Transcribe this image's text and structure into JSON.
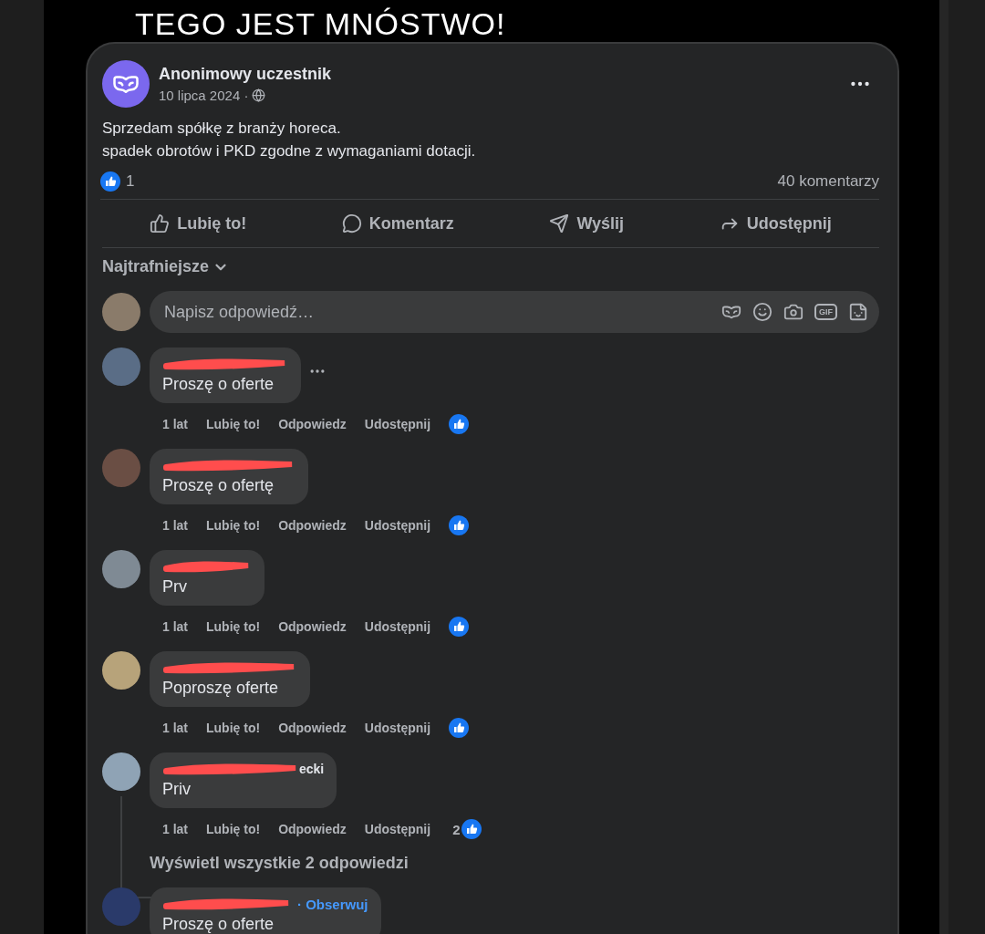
{
  "heading": "TEGO JEST MNÓSTWO!",
  "post": {
    "author": "Anonimowy uczestnik",
    "date": "10 lipca 2024 ·",
    "body": [
      "Sprzedam spółkę z branży horeca.",
      "spadek obrotów i PKD zgodne z wymaganiami dotacji."
    ],
    "like_count": "1",
    "comment_count": "40 komentarzy",
    "actions": [
      {
        "kind": "like",
        "label": "Lubię to!"
      },
      {
        "kind": "comment",
        "label": "Komentarz"
      },
      {
        "kind": "send",
        "label": "Wyślij"
      },
      {
        "kind": "share",
        "label": "Udostępnij"
      }
    ]
  },
  "sort": "Najtrafniejsze",
  "reply_field": {
    "placeholder": "Napisz odpowiedź…",
    "gif_label": "GIF"
  },
  "comments": [
    {
      "redacted": true,
      "text": "Proszę o oferte",
      "more": true,
      "time": "1 lat",
      "like": "Lubię to!",
      "reply": "Odpowiedz",
      "share": "Udostępnij"
    },
    {
      "redacted": true,
      "text": "Proszę o ofertę",
      "time": "1 lat",
      "like": "Lubię to!",
      "reply": "Odpowiedz",
      "share": "Udostępnij"
    },
    {
      "redacted": true,
      "text": "Prv",
      "time": "1 lat",
      "like": "Lubię to!",
      "reply": "Odpowiedz",
      "share": "Udostępnij"
    },
    {
      "redacted": true,
      "text": "Poproszę oferte",
      "time": "1 lat",
      "like": "Lubię to!",
      "reply": "Odpowiedz",
      "share": "Udostępnij"
    },
    {
      "redacted": true,
      "name_tail": "ecki",
      "text": "Priv",
      "time": "1 lat",
      "like": "Lubię to!",
      "reply": "Odpowiedz",
      "share": "Udostępnij",
      "reactions": "2",
      "replies": "Wyświetl wszystkie 2 odpowiedzi"
    },
    {
      "redacted": true,
      "follow": "· Obserwuj",
      "text": "Proszę o oferte"
    }
  ]
}
